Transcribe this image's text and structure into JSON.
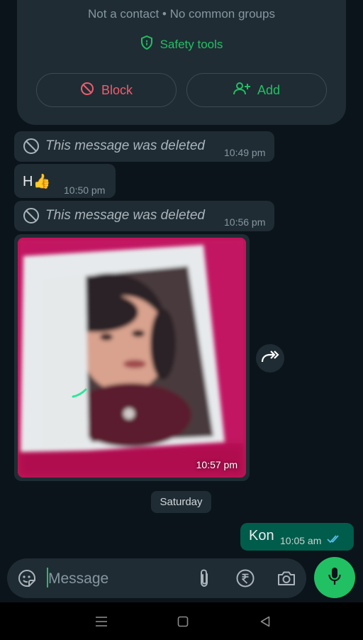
{
  "contact_card": {
    "subtitle": "Not a contact • No common groups",
    "safety_tools": "Safety tools",
    "block_label": "Block",
    "add_label": "Add"
  },
  "messages": [
    {
      "type": "deleted",
      "text": "This message was deleted",
      "time": "10:49 pm"
    },
    {
      "type": "text",
      "text": "H👍",
      "time": "10:50 pm"
    },
    {
      "type": "deleted",
      "text": "This message was deleted",
      "time": "10:56 pm"
    },
    {
      "type": "image",
      "time": "10:57 pm"
    }
  ],
  "day_separator": "Saturday",
  "outgoing": {
    "text": "Kon",
    "time": "10:05 am",
    "status": "read"
  },
  "composer": {
    "placeholder": "Message"
  },
  "colors": {
    "background": "#0b141a",
    "bubble_incoming": "#1f2c34",
    "bubble_outgoing": "#005c4b",
    "accent_green": "#21c063",
    "block_red": "#f15c6d",
    "read_ticks": "#53bdeb"
  },
  "icons": [
    "shield-icon",
    "block-icon",
    "add-person-icon",
    "forward-icon",
    "sticker-icon",
    "attach-icon",
    "rupee-icon",
    "camera-icon",
    "mic-icon",
    "menu-icon",
    "home-icon",
    "back-icon"
  ]
}
